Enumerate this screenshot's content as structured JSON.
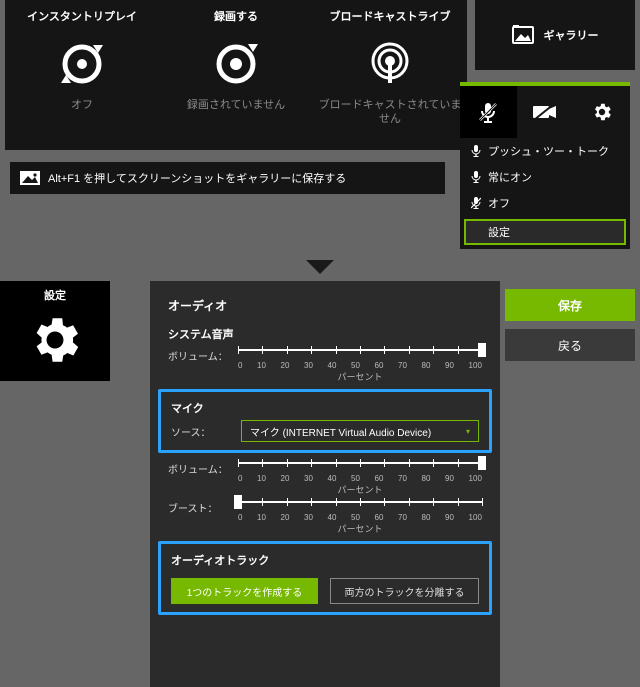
{
  "top": {
    "tiles": [
      {
        "title": "インスタントリプレイ",
        "status": "オフ"
      },
      {
        "title": "録画する",
        "status": "録画されていません"
      },
      {
        "title": "ブロードキャストライブ",
        "status": "ブロードキャストされていません"
      }
    ],
    "gallery_label": "ギャラリー",
    "hint": "Alt+F1 を押してスクリーンショットをギャラリーに保存する"
  },
  "side": {
    "items": [
      {
        "label": "プッシュ・ツー・トーク"
      },
      {
        "label": "常にオン"
      },
      {
        "label": "オフ"
      }
    ],
    "settings_label": "設定"
  },
  "settings": {
    "tile_label": "設定",
    "section_audio": "オーディオ",
    "system_sound": "システム音声",
    "volume_label": "ボリューム：",
    "mic_section": "マイク",
    "source_label": "ソース：",
    "source_value": "マイク (INTERNET Virtual Audio Device)",
    "boost_label": "ブースト：",
    "percent_label": "パーセント",
    "track_section": "オーディオトラック",
    "track_one": "1つのトラックを作成する",
    "track_split": "両方のトラックを分離する",
    "ticks": [
      "0",
      "10",
      "20",
      "30",
      "40",
      "50",
      "60",
      "70",
      "80",
      "90",
      "100"
    ],
    "sys_volume": 100,
    "mic_volume": 100,
    "boost": 0
  },
  "buttons": {
    "save": "保存",
    "back": "戻る"
  }
}
